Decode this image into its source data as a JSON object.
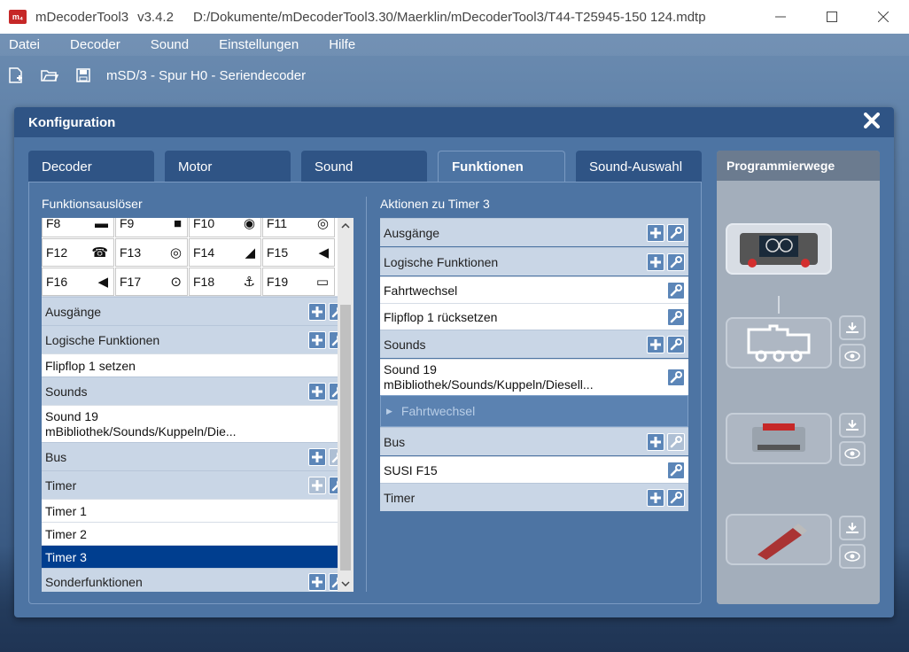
{
  "window": {
    "app_name": "mDecoderTool3",
    "version": "v3.4.2",
    "file_path": "D:/Dokumente/mDecoderTool3.30/Maerklin/mDecoderTool3/T44-T25945-150 124.mdtp",
    "logo_text": "m₄"
  },
  "menu": [
    "Datei",
    "Decoder",
    "Sound",
    "Einstellungen",
    "Hilfe"
  ],
  "toolbar": {
    "decoder_name": "mSD/3 - Spur H0 - Seriendecoder"
  },
  "dialog": {
    "title": "Konfiguration",
    "tabs": [
      {
        "label": "Decoder",
        "active": false
      },
      {
        "label": "Motor",
        "active": false
      },
      {
        "label": "Sound",
        "active": false
      },
      {
        "label": "Funktionen",
        "active": true
      },
      {
        "label": "Sound-Auswahl",
        "active": false
      }
    ]
  },
  "left": {
    "label": "Funktionsauslöser",
    "functions": [
      {
        "key": "F8",
        "icon": "horn-icon",
        "glyph": "▬"
      },
      {
        "key": "F9",
        "icon": "block-icon",
        "glyph": "■"
      },
      {
        "key": "F10",
        "icon": "signal-icon",
        "glyph": "◉"
      },
      {
        "key": "F11",
        "icon": "radio-icon",
        "glyph": "◎"
      },
      {
        "key": "F12",
        "icon": "sound-bell-icon",
        "glyph": "☎"
      },
      {
        "key": "F13",
        "icon": "antenna-icon",
        "glyph": "◎"
      },
      {
        "key": "F14",
        "icon": "turtle-icon",
        "glyph": "◢"
      },
      {
        "key": "F15",
        "icon": "horn-sound-icon",
        "glyph": "◀"
      },
      {
        "key": "F16",
        "icon": "speaker-icon",
        "glyph": "◀"
      },
      {
        "key": "F17",
        "icon": "wheel-sound-icon",
        "glyph": "⊙"
      },
      {
        "key": "F18",
        "icon": "coupler-icon",
        "glyph": "⚓"
      },
      {
        "key": "F19",
        "icon": "radio-loco-icon",
        "glyph": "▭"
      }
    ],
    "sections": {
      "ausgaenge": "Ausgänge",
      "logische": "Logische Funktionen",
      "logische_item": "Flipflop 1 setzen",
      "sounds": "Sounds",
      "sounds_item_1": "Sound 19",
      "sounds_item_2": "mBibliothek/Sounds/Kuppeln/Die...",
      "bus": "Bus",
      "timer": "Timer",
      "timer_items": [
        "Timer 1",
        "Timer 2",
        "Timer 3"
      ],
      "sonder": "Sonderfunktionen"
    }
  },
  "right": {
    "label": "Aktionen zu Timer 3",
    "ausgaenge": "Ausgänge",
    "logische": "Logische Funktionen",
    "logische_items": [
      "Fahrtwechsel",
      "Flipflop 1 rücksetzen"
    ],
    "sounds": "Sounds",
    "sounds_item_1": "Sound 19",
    "sounds_item_2": "mBibliothek/Sounds/Kuppeln/Diesell...",
    "sub_item": "Fahrtwechsel",
    "bus": "Bus",
    "bus_item": "SUSI F15",
    "timer": "Timer"
  },
  "prog": {
    "title": "Programmierwege"
  }
}
